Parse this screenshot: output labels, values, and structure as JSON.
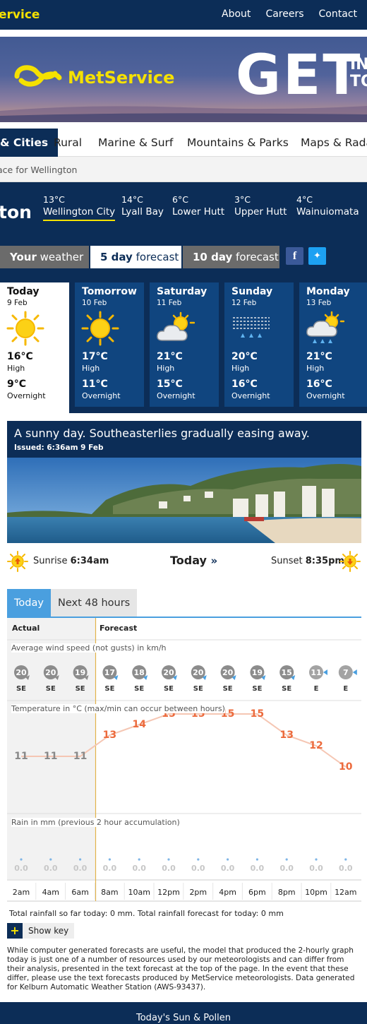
{
  "topbar": {
    "brand": "ervice",
    "nav": [
      "About",
      "Careers",
      "Contact"
    ]
  },
  "banner": {
    "logo_text": "MetService",
    "headline": "GET",
    "sub": [
      "IN",
      "TO"
    ]
  },
  "region_tabs": [
    "& Cities",
    "Rural",
    "Marine & Surf",
    "Mountains & Parks",
    "Maps & Rada"
  ],
  "breadcrumb": "ace for Wellington",
  "location": {
    "title": "ton",
    "places": [
      {
        "temp": "13°C",
        "name": "Wellington City"
      },
      {
        "temp": "14°C",
        "name": "Lyall Bay"
      },
      {
        "temp": "6°C",
        "name": "Lower Hutt"
      },
      {
        "temp": "3°C",
        "name": "Upper Hutt"
      },
      {
        "temp": "4°C",
        "name": "Wainuiomata"
      }
    ]
  },
  "forecast_tabs": {
    "your": {
      "bold": "Your",
      "rest": " weather"
    },
    "five": {
      "bold": "5 day",
      "rest": " forecast"
    },
    "ten": {
      "bold": "10 day",
      "rest": " forecast"
    }
  },
  "days": [
    {
      "name": "Today",
      "date": "9 Feb",
      "icon": "sun-icon",
      "high": "16°C",
      "high_label": "High",
      "low": "9°C",
      "low_label": "Overnight"
    },
    {
      "name": "Tomorrow",
      "date": "10 Feb",
      "icon": "sun-icon",
      "high": "17°C",
      "high_label": "High",
      "low": "11°C",
      "low_label": "Overnight"
    },
    {
      "name": "Saturday",
      "date": "11 Feb",
      "icon": "partly-cloudy-icon",
      "high": "21°C",
      "high_label": "High",
      "low": "15°C",
      "low_label": "Overnight"
    },
    {
      "name": "Sunday",
      "date": "12 Feb",
      "icon": "fog-drizzle-icon",
      "high": "20°C",
      "high_label": "High",
      "low": "16°C",
      "low_label": "Overnight"
    },
    {
      "name": "Monday",
      "date": "13 Feb",
      "icon": "sun-rain-icon",
      "high": "21°C",
      "high_label": "High",
      "low": "16°C",
      "low_label": "Overnight"
    }
  ],
  "summary": {
    "headline": "A sunny day. Southeasterlies gradually easing away.",
    "issued": "Issued: 6:36am 9 Feb"
  },
  "sun": {
    "sunrise_label": "Sunrise",
    "sunrise": "6:34am",
    "center": "Today",
    "sunset_label": "Sunset",
    "sunset": "8:35pm"
  },
  "graph_tabs": [
    "Today",
    "Next 48 hours"
  ],
  "graph": {
    "actual": "Actual",
    "forecast": "Forecast",
    "wind_label": "Average wind speed (not gusts) in km/h",
    "temp_label": "Temperature in °C (max/min can occur between hours)",
    "rain_label": "Rain in mm (previous 2 hour accumulation)",
    "times": [
      "2am",
      "4am",
      "6am",
      "8am",
      "10am",
      "12pm",
      "2pm",
      "4pm",
      "6pm",
      "8pm",
      "10pm",
      "12am"
    ],
    "wind": [
      20,
      20,
      19,
      17,
      18,
      20,
      20,
      20,
      19,
      15,
      11,
      7
    ],
    "wind_dir": [
      "SE",
      "SE",
      "SE",
      "SE",
      "SE",
      "SE",
      "SE",
      "SE",
      "SE",
      "SE",
      "E",
      "E"
    ],
    "temps": [
      11,
      11,
      11,
      13,
      14,
      15,
      15,
      15,
      15,
      13,
      12,
      10
    ],
    "rain": [
      "0.0",
      "0.0",
      "0.0",
      "0.0",
      "0.0",
      "0.0",
      "0.0",
      "0.0",
      "0.0",
      "0.0",
      "0.0",
      "0.0"
    ],
    "actual_count": 3
  },
  "rainfall_text": "Total rainfall so far today: 0 mm. Total rainfall forecast for today: 0 mm",
  "show_key": "Show key",
  "disclaimer": "While computer generated forecasts are useful, the model that produced the 2-hourly graph today is just one of a number of resources used by our meteorologists and can differ from their analysis, presented in the text forecast at the top of the page. In the event that these differ, please use the text forecasts produced by MetService meteorologists. Data generated for Kelburn Automatic Weather Station (AWS-93437).",
  "footer": "Today's Sun & Pollen"
}
